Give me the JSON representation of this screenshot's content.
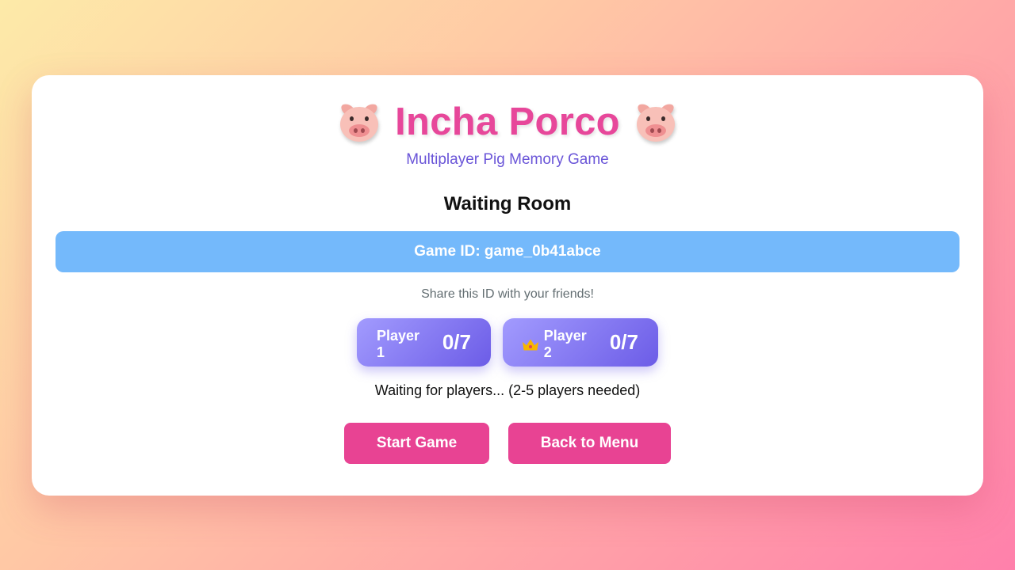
{
  "header": {
    "title": "Incha Porco",
    "left_icon": "pig-face-icon",
    "right_icon": "pig-face-icon",
    "subtitle": "Multiplayer Pig Memory Game"
  },
  "room": {
    "title": "Waiting Room",
    "game_id_text": "Game ID: game_0b41abce",
    "share_text": "Share this ID with your friends!"
  },
  "players": [
    {
      "name": "Player 1",
      "score": "0/7",
      "host": false
    },
    {
      "name": "Player 2",
      "score": "0/7",
      "host": true,
      "icon": "crown-icon"
    }
  ],
  "status_text": "Waiting for players... (2-5 players needed)",
  "actions": {
    "start_label": "Start Game",
    "back_label": "Back to Menu"
  },
  "colors": {
    "title": "#e7479a",
    "subtitle": "#6a55d8",
    "game_id_bg": "#74b9fb",
    "player_card_from": "#a29bfe",
    "player_card_to": "#6c5ce7",
    "button_bg": "#e84393"
  }
}
